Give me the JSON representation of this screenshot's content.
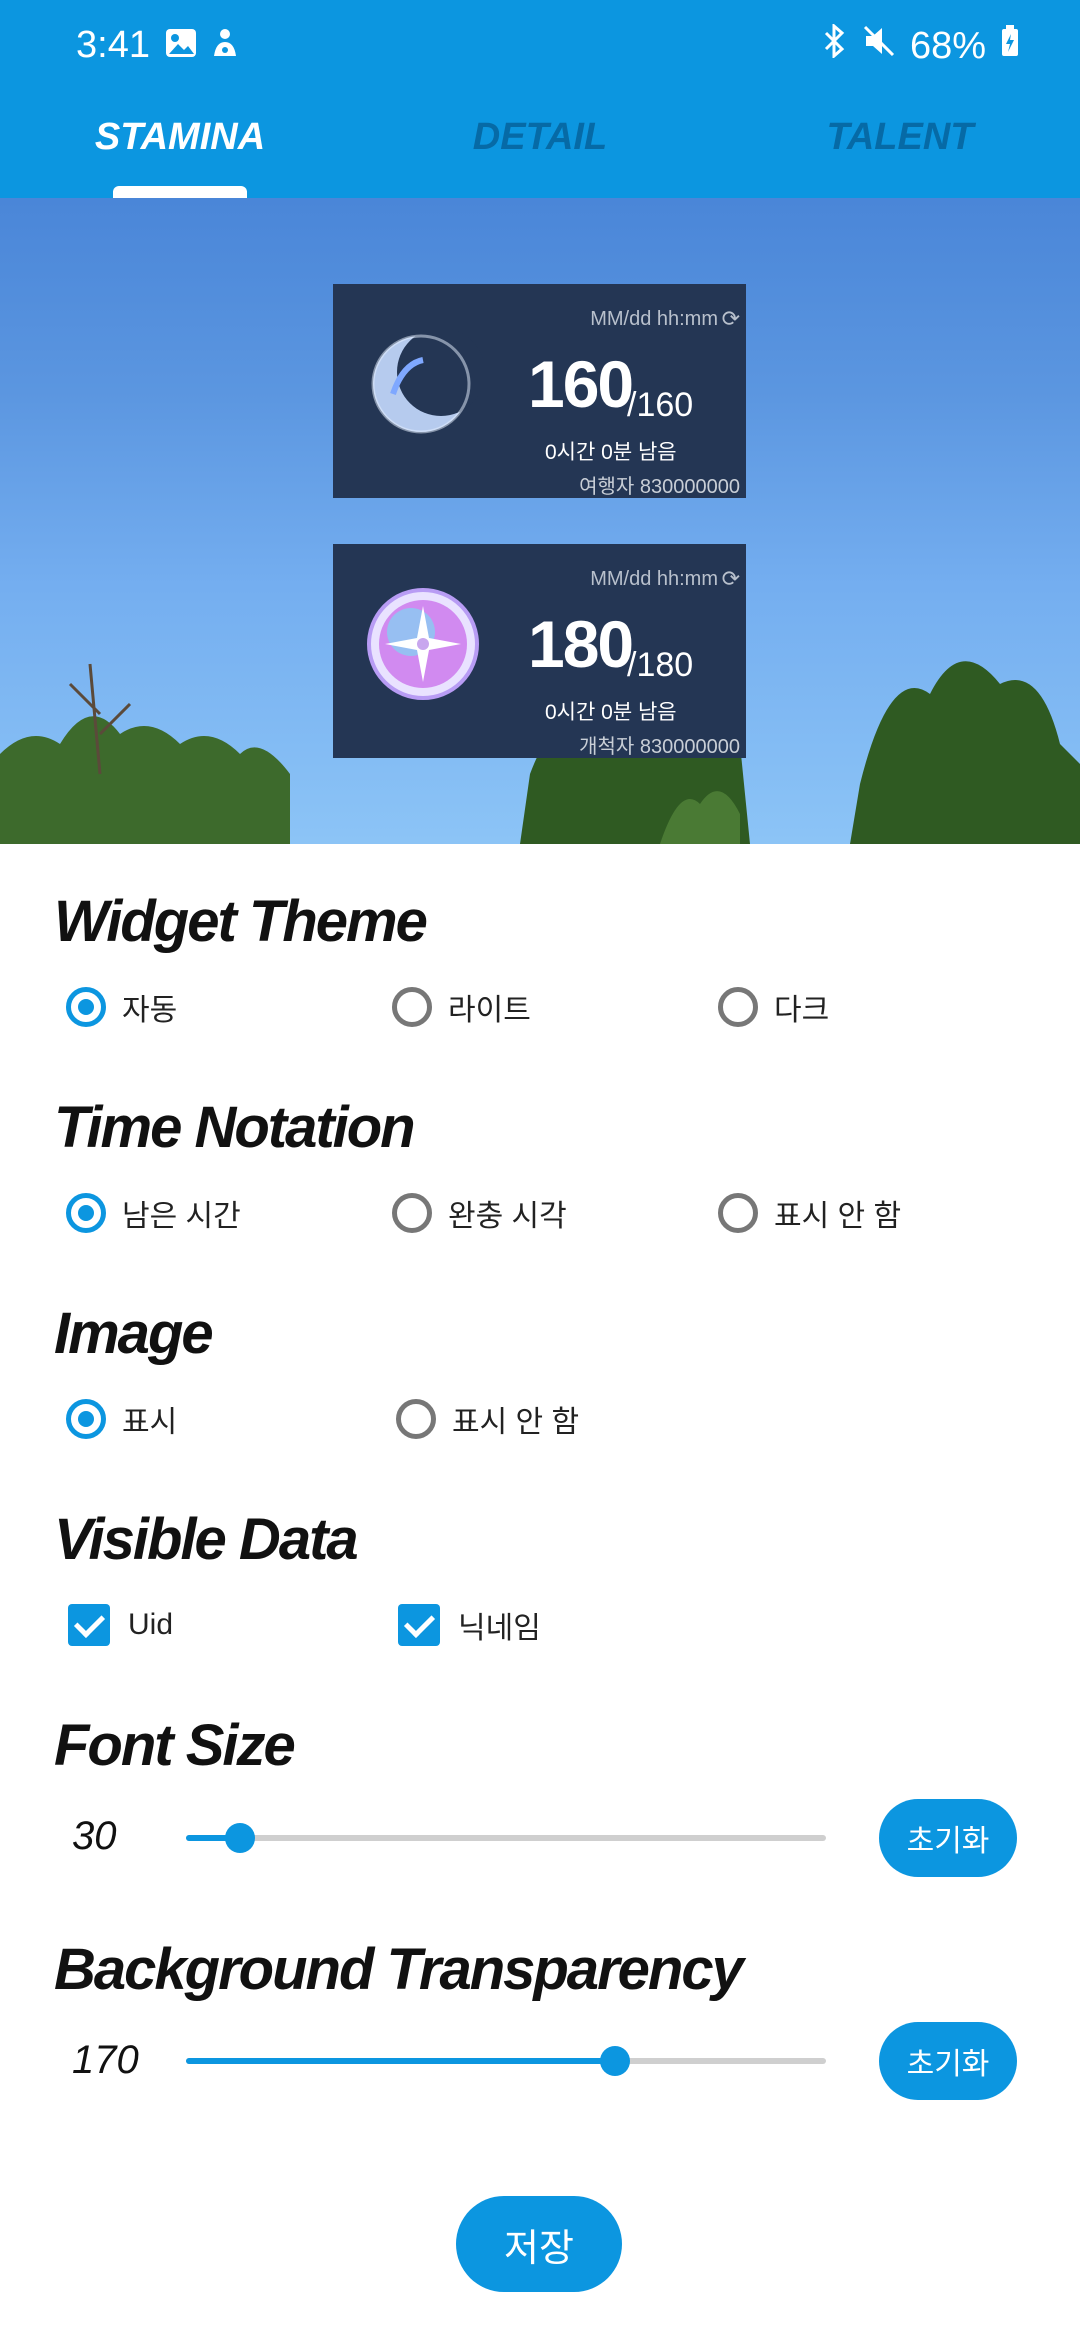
{
  "status_bar": {
    "time": "3:41",
    "battery": "68%"
  },
  "tabs": [
    {
      "label": "STAMINA",
      "active": true
    },
    {
      "label": "DETAIL",
      "active": false
    },
    {
      "label": "TALENT",
      "active": false
    }
  ],
  "widgets": [
    {
      "icon": "crescent-moon-icon",
      "format": "MM/dd hh:mm",
      "value": "160",
      "max": "/160",
      "remaining": "0시간 0분 남음",
      "user": "여행자  830000000"
    },
    {
      "icon": "compass-orb-icon",
      "format": "MM/dd hh:mm",
      "value": "180",
      "max": "/180",
      "remaining": "0시간 0분 남음",
      "user": "개척자  830000000"
    }
  ],
  "sections": {
    "widget_theme": {
      "title": "Widget Theme",
      "options": [
        "자동",
        "라이트",
        "다크"
      ],
      "selected": 0
    },
    "time_notation": {
      "title": "Time Notation",
      "options": [
        "남은 시간",
        "완충 시각",
        "표시 안 함"
      ],
      "selected": 0
    },
    "image": {
      "title": "Image",
      "options": [
        "표시",
        "표시 안 함"
      ],
      "selected": 0
    },
    "visible_data": {
      "title": "Visible Data",
      "options": [
        "Uid",
        "닉네임"
      ],
      "checked": [
        true,
        true
      ]
    },
    "font_size": {
      "title": "Font Size",
      "value": "30",
      "fraction": 0.085,
      "reset_label": "초기화"
    },
    "bg_transparency": {
      "title": "Background Transparency",
      "value": "170",
      "fraction": 0.67,
      "reset_label": "초기화"
    }
  },
  "save_label": "저장",
  "colors": {
    "accent": "#0c96e0",
    "widget_bg": "#243654"
  }
}
